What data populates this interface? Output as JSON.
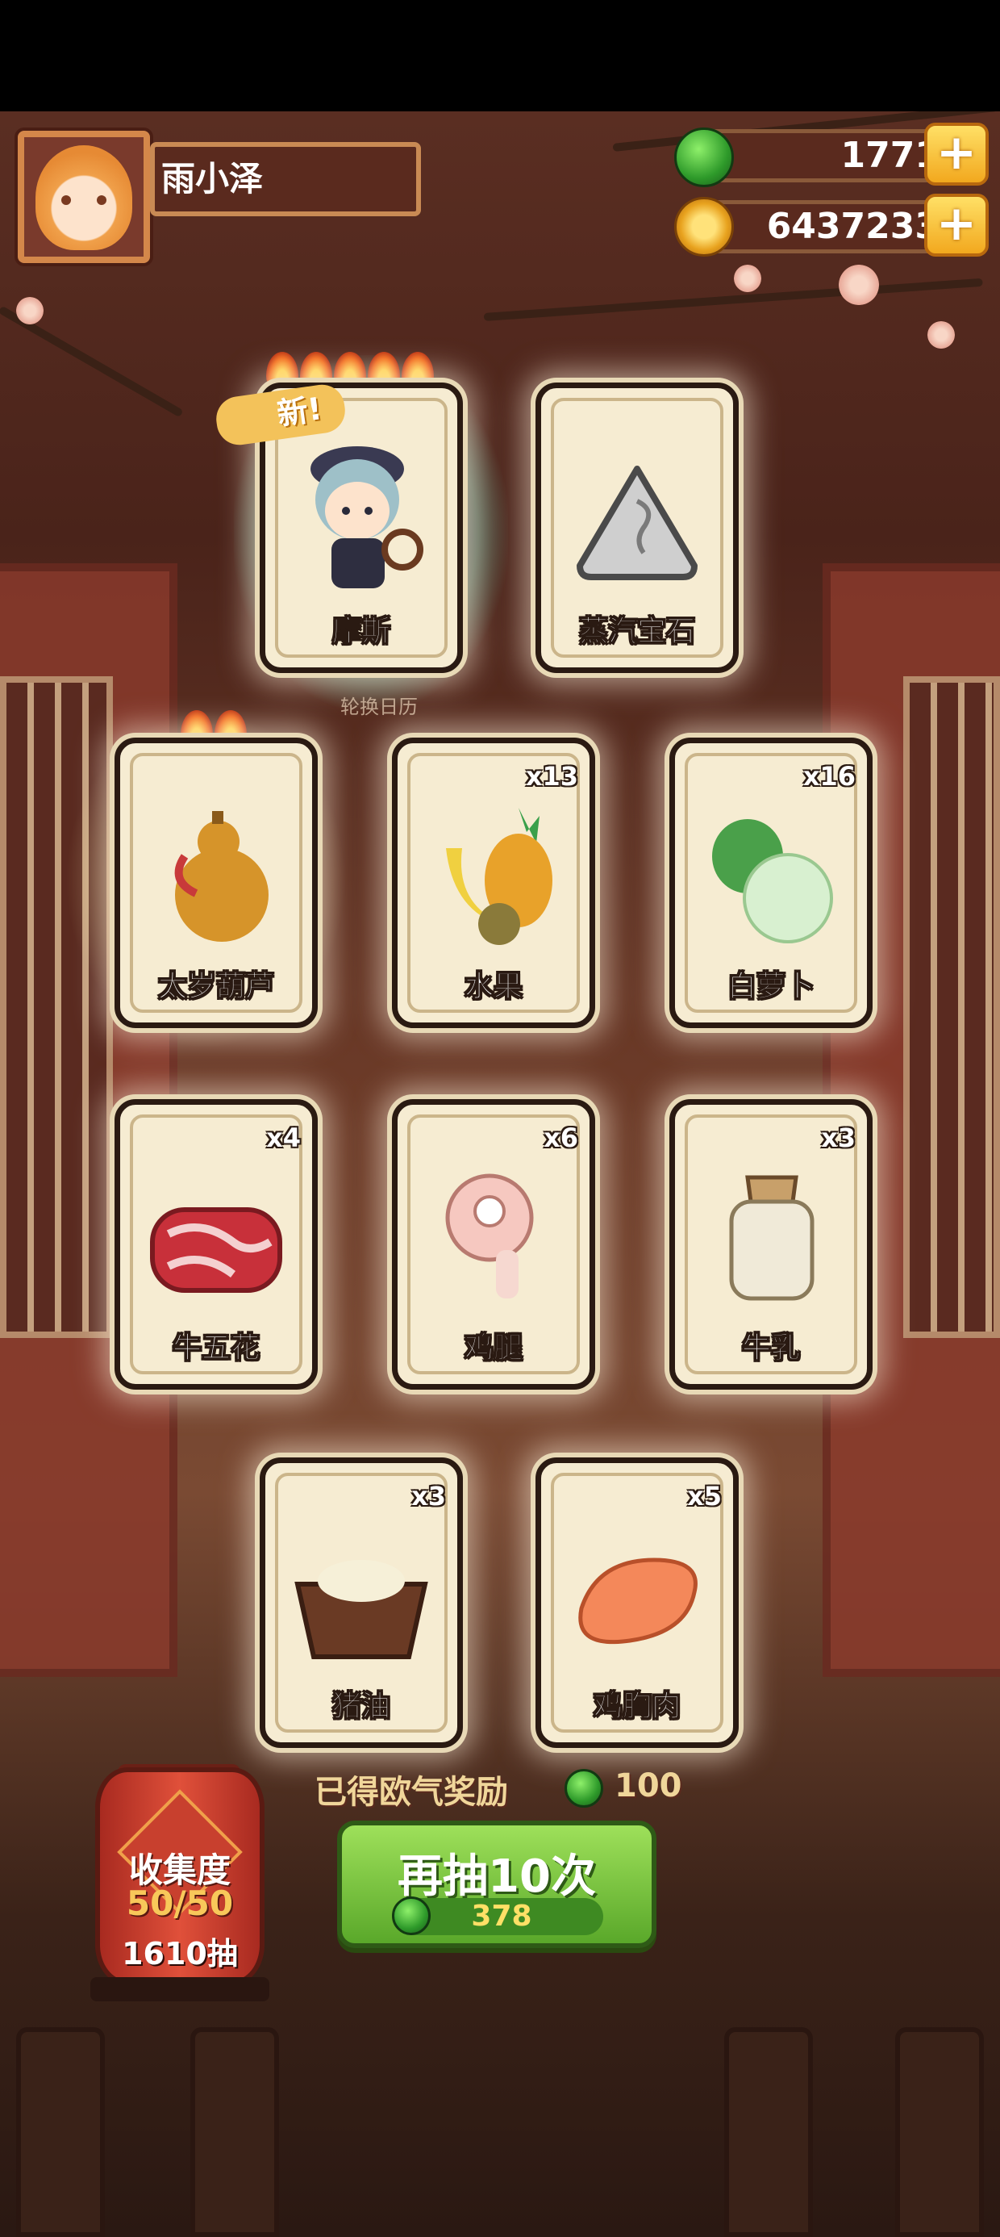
{
  "player": {
    "name": "雨小泽"
  },
  "currency": {
    "jade": "1771",
    "coins": "6437233",
    "plus_symbol": "+"
  },
  "cards": [
    {
      "label": "摩斯",
      "qty": "",
      "flames": 5,
      "new": true
    },
    {
      "label": "蒸汽宝石",
      "qty": ""
    },
    {
      "label": "太岁葫芦",
      "qty": "",
      "flames": 2
    },
    {
      "label": "水果",
      "qty": "x13"
    },
    {
      "label": "白萝卜",
      "qty": "x16"
    },
    {
      "label": "牛五花",
      "qty": "x4"
    },
    {
      "label": "鸡腿",
      "qty": "x6"
    },
    {
      "label": "牛乳",
      "qty": "x3"
    },
    {
      "label": "猪油",
      "qty": "x3"
    },
    {
      "label": "鸡胸肉",
      "qty": "x5"
    }
  ],
  "new_tag": "新!",
  "caption": "轮换日历",
  "reward": {
    "text": "已得欧气奖励",
    "amount": "100"
  },
  "collection": {
    "title": "收集度",
    "progress": "50/50",
    "draws": "1610抽"
  },
  "draw_button": {
    "label": "再抽10次",
    "cost": "378"
  }
}
